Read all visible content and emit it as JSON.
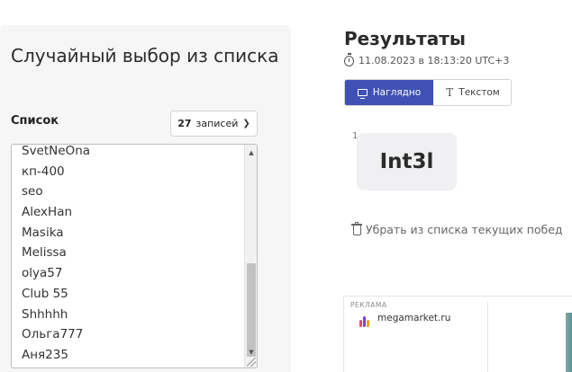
{
  "left": {
    "title": "Случайный выбор из списка",
    "list_label": "Список",
    "count_select": {
      "count": "27",
      "unit": "записей"
    },
    "list_lines": [
      "SvetNeOna",
      "кп-400",
      "seo",
      "AlexHan",
      "Masika",
      "Melissa",
      "olya57",
      "Club 55",
      "Shhhhh",
      "Ольга777",
      "Аня235"
    ]
  },
  "results": {
    "title": "Результаты",
    "timestamp": "11.08.2023 в 18:13:20 UTC+3",
    "tabs": [
      {
        "label": "Наглядно",
        "active": true
      },
      {
        "label": "Текстом",
        "active": false
      }
    ],
    "winner": {
      "rank": "1",
      "name": "Int3l"
    },
    "remove_winners": "Убрать из списка текущих побед"
  },
  "ad": {
    "label": "РЕКЛАМА",
    "domain": "megamarket.ru"
  },
  "colors": {
    "accent": "#3f51b5",
    "panel_bg": "#f6f6f7"
  }
}
